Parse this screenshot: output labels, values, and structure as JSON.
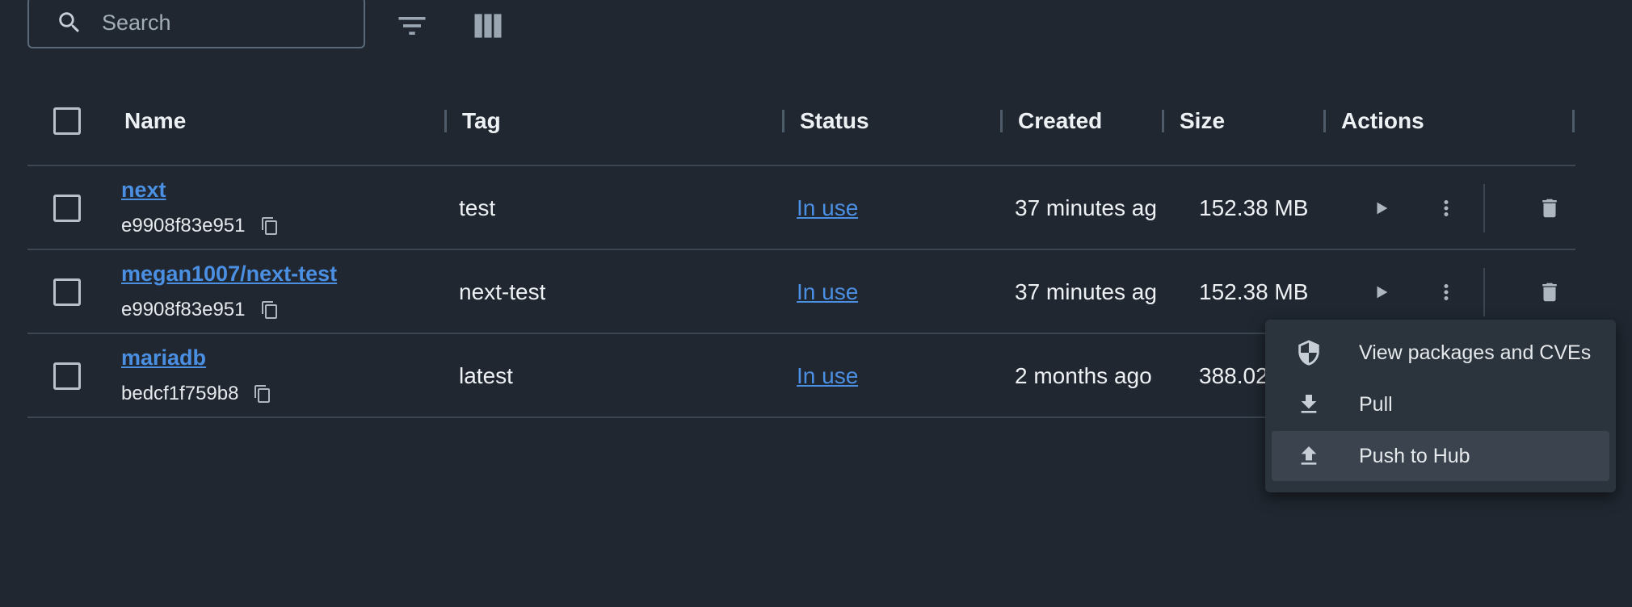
{
  "toolbar": {
    "search_placeholder": "Search",
    "search_icon": "search-icon",
    "filter_icon": "filter-icon",
    "columns_icon": "columns-icon"
  },
  "table": {
    "headers": [
      "Name",
      "Tag",
      "Status",
      "Created",
      "Size",
      "Actions"
    ],
    "rows": [
      {
        "name": "next",
        "hash": "e9908f83e951",
        "tag": "test",
        "status": "In use",
        "created": "37 minutes ag",
        "size": "152.38 MB"
      },
      {
        "name": "megan1007/next-test",
        "hash": "e9908f83e951",
        "tag": "next-test",
        "status": "In use",
        "created": "37 minutes ag",
        "size": "152.38 MB"
      },
      {
        "name": "mariadb",
        "hash": "bedcf1f759b8",
        "tag": "latest",
        "status": "In use",
        "created": "2 months ago",
        "size": "388.02"
      }
    ]
  },
  "menu": {
    "items": [
      {
        "label": "View packages and CVEs",
        "icon": "shield-icon"
      },
      {
        "label": "Pull",
        "icon": "download-icon"
      },
      {
        "label": "Push to Hub",
        "icon": "upload-icon"
      }
    ],
    "active_index": 2
  },
  "colors": {
    "background": "#202730",
    "link": "#4b8fe3",
    "menu_bg": "#2b333c",
    "divider": "#3b4652"
  }
}
